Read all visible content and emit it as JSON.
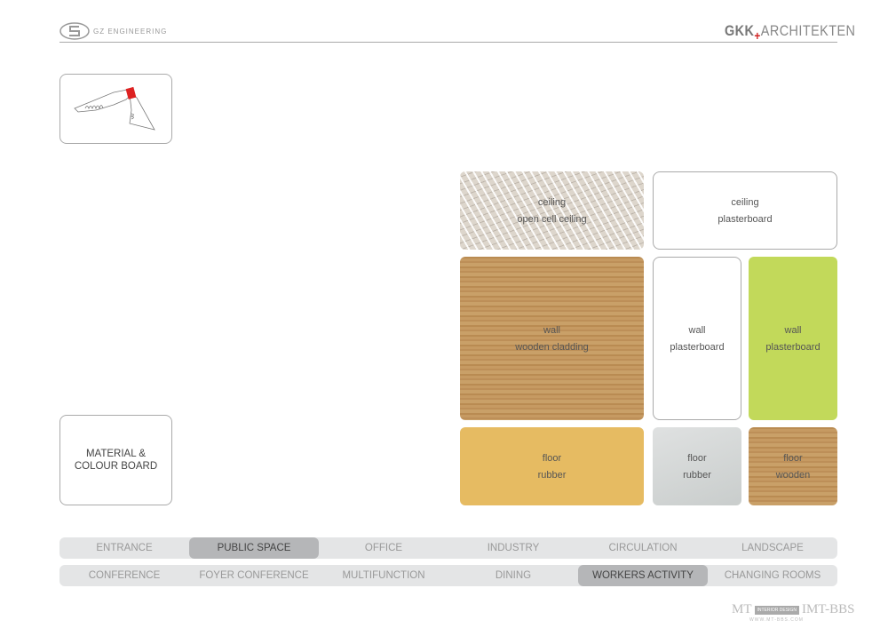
{
  "header": {
    "left_logo": "GZ ENGINEERING",
    "right_logo": {
      "part1": "GKK",
      "part2": "ARCHITEKTEN"
    }
  },
  "board_title": "MATERIAL & COLOUR BOARD",
  "tiles": [
    {
      "type": "ceiling",
      "material": "open cell ceiling"
    },
    {
      "type": "ceiling",
      "material": "plasterboard"
    },
    {
      "type": "wall",
      "material": "wooden cladding"
    },
    {
      "type": "wall",
      "material": "plasterboard",
      "color": "#ffffff"
    },
    {
      "type": "wall",
      "material": "plasterboard",
      "color": "#c2d95a"
    },
    {
      "type": "floor",
      "material": "rubber",
      "color": "#e6bb62"
    },
    {
      "type": "floor",
      "material": "rubber",
      "color": "#d3d6d6"
    },
    {
      "type": "floor",
      "material": "wooden"
    }
  ],
  "nav_primary": [
    "ENTRANCE",
    "PUBLIC SPACE",
    "OFFICE",
    "INDUSTRY",
    "CIRCULATION",
    "LANDSCAPE"
  ],
  "nav_primary_selected": "PUBLIC SPACE",
  "nav_secondary": [
    "CONFERENCE",
    "FOYER CONFERENCE",
    "MULTIFUNCTION",
    "DINING",
    "WORKERS ACTIVITY",
    "CHANGING ROOMS"
  ],
  "nav_secondary_selected": "WORKERS ACTIVITY",
  "watermark": {
    "brand": "MT",
    "badge": "INTERIOR DESIGN",
    "site": "IMT-BBS",
    "url": "WWW.MT-BBS.COM"
  }
}
